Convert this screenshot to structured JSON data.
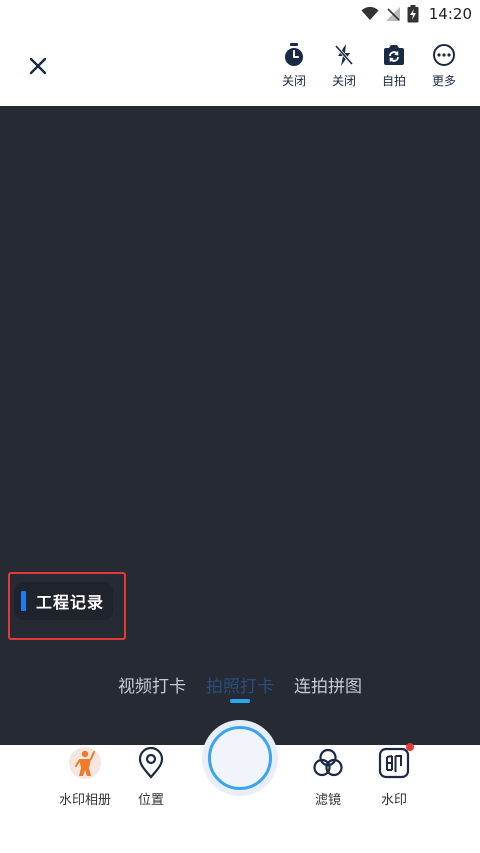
{
  "status": {
    "time": "14:20"
  },
  "topbar": {
    "actions": [
      {
        "label": "关闭",
        "icon": "timer-icon"
      },
      {
        "label": "关闭",
        "icon": "flash-off-icon"
      },
      {
        "label": "自拍",
        "icon": "camera-flip-icon"
      },
      {
        "label": "更多",
        "icon": "more-icon"
      }
    ]
  },
  "watermark": {
    "title": "工程记录",
    "accent": "#1e7cf2"
  },
  "modes": [
    "视频打卡",
    "拍照打卡",
    "连拍拼图"
  ],
  "active_mode": "拍照打卡",
  "bottom": {
    "album": "水印相册",
    "location": "位置",
    "filter": "滤镜",
    "watermark": "水印"
  },
  "colors": {
    "viewfinder": "#252a33",
    "accent": "#29a8f2",
    "highlight_box": "#e53935"
  }
}
